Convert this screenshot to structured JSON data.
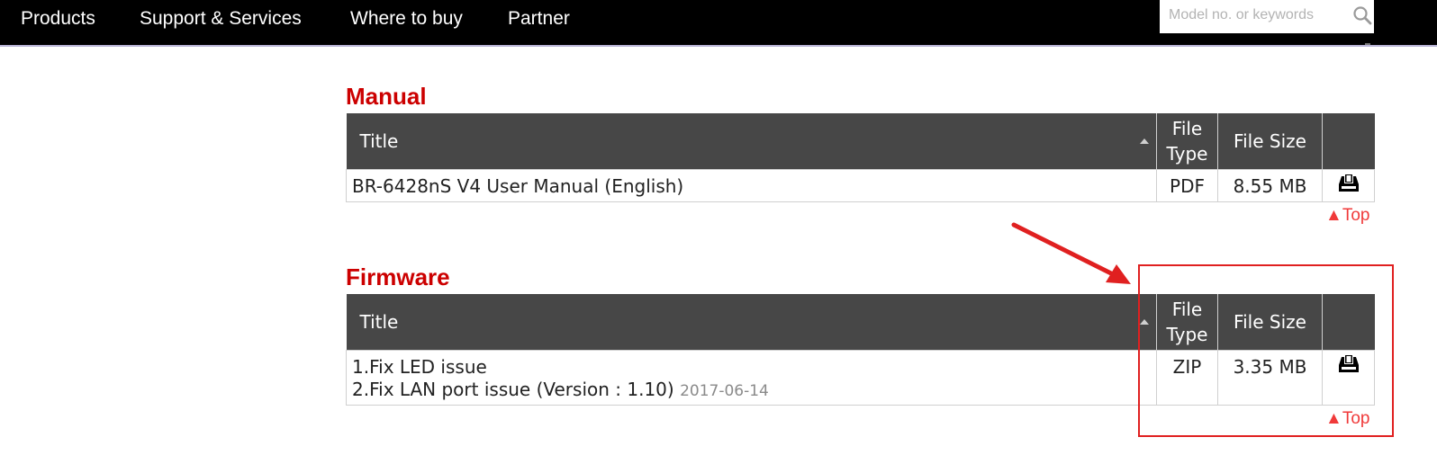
{
  "nav": {
    "items": [
      "Products",
      "Support & Services",
      "Where to buy",
      "Partner"
    ],
    "search_placeholder": "Model no. or keywords"
  },
  "manual": {
    "heading": "Manual",
    "columns": {
      "title": "Title",
      "file_type_1": "File",
      "file_type_2": "Type",
      "file_size": "File Size"
    },
    "rows": [
      {
        "title": "BR-6428nS V4 User Manual (English)",
        "type": "PDF",
        "size": "8.55 MB"
      }
    ],
    "top_link": "Top"
  },
  "firmware": {
    "heading": "Firmware",
    "columns": {
      "title": "Title",
      "file_type_1": "File",
      "file_type_2": "Type",
      "file_size": "File Size"
    },
    "rows": [
      {
        "line1": "1.Fix LED issue",
        "line2": "2.Fix LAN port issue (Version : 1.10)",
        "date": "2017-06-14",
        "type": "ZIP",
        "size": "3.35 MB"
      }
    ],
    "top_link": "Top"
  },
  "icons": {
    "search": "search-icon",
    "download": "download-icon",
    "sort": "sort-arrow-icon",
    "top": "triangle-up-icon"
  },
  "colors": {
    "nav_bg": "#000000",
    "heading": "#cc0000",
    "table_header": "#474747",
    "top_link": "#f03a3a",
    "annotation": "#e02020"
  }
}
